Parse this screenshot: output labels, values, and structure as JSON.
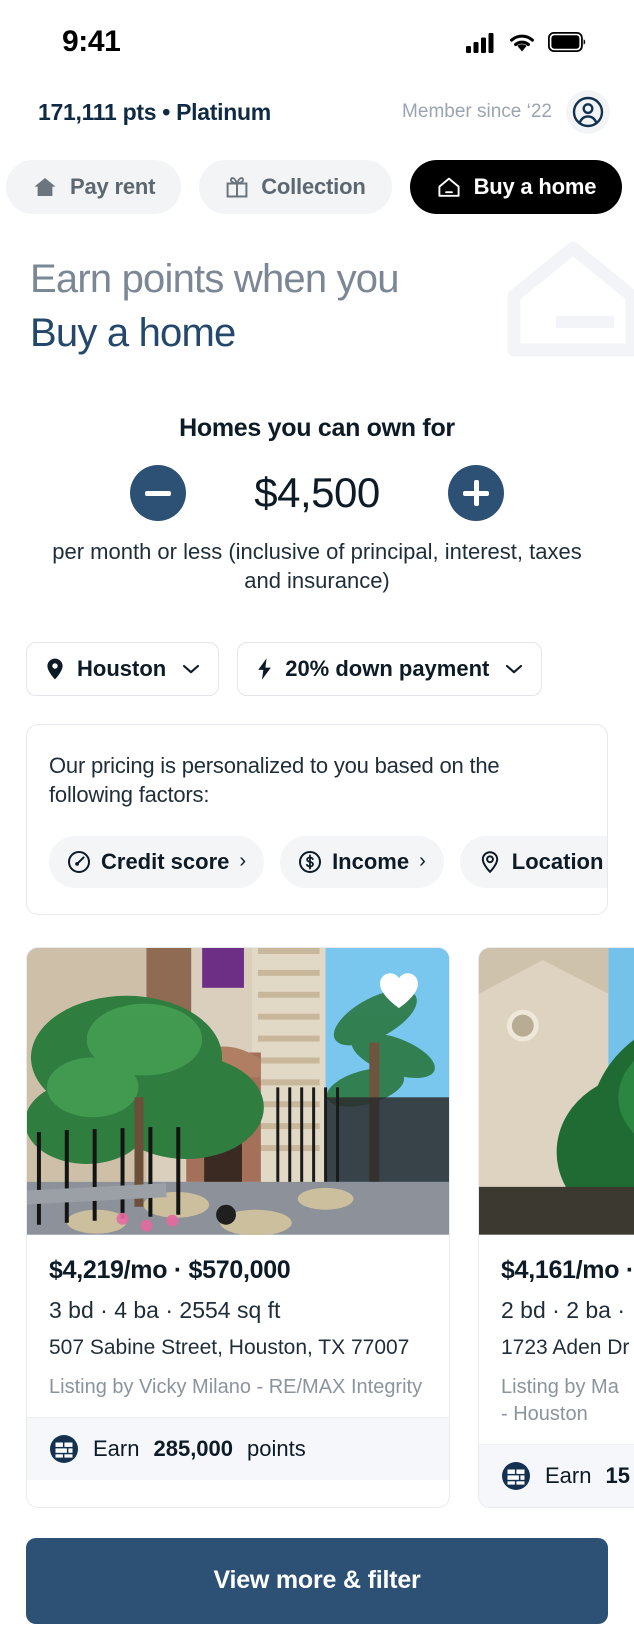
{
  "status_bar": {
    "time": "9:41",
    "cellular_icon": "signal-bars-icon",
    "wifi_icon": "wifi-icon",
    "battery_icon": "battery-icon"
  },
  "header": {
    "points_tier": "171,111 pts • Platinum",
    "member_since": "Member since ‘22",
    "avatar_icon": "user-avatar-icon"
  },
  "tabs": [
    {
      "label": "Pay rent",
      "icon": "house-filled-icon",
      "active": false
    },
    {
      "label": "Collection",
      "icon": "gift-icon",
      "active": false
    },
    {
      "label": "Buy a home",
      "icon": "house-outline-icon",
      "active": true
    }
  ],
  "hero": {
    "line1": "Earn points when you",
    "line2": "Buy a home",
    "watermark_icon": "house-watermark-icon"
  },
  "price_stepper": {
    "title": "Homes you can own for",
    "decrement_label": "−",
    "increment_label": "+",
    "amount": "$4,500",
    "subtitle": "per month or less (inclusive of principal, interest, taxes and insurance)"
  },
  "filters": [
    {
      "label": "Houston",
      "icon": "location-pin-icon",
      "caret": "chevron-down-icon"
    },
    {
      "label": "20% down payment",
      "icon": "bolt-icon",
      "caret": "chevron-down-icon"
    }
  ],
  "personalization": {
    "text": "Our pricing is personalized to you based on the following factors:",
    "factors": [
      {
        "label": "Credit score",
        "icon": "speedometer-icon",
        "chevron": "›"
      },
      {
        "label": "Income",
        "icon": "dollar-circle-icon",
        "chevron": "›"
      },
      {
        "label": "Location",
        "icon": "location-target-icon",
        "chevron": "›"
      }
    ]
  },
  "listings": [
    {
      "photo_alt": "brick-townhouse-entry-with-tree",
      "favorite_icon": "heart-filled-icon",
      "price": "$4,219/mo · $570,000",
      "specs": "3 bd · 4 ba · 2554 sq ft",
      "address": "507 Sabine Street, Houston, TX 77007",
      "agent": "Listing by Vicky Milano - RE/MAX Integrity",
      "points_icon": "points-badge-icon",
      "points_prefix": "Earn ",
      "points_value": "285,000",
      "points_suffix": " points"
    },
    {
      "photo_alt": "house-behind-large-green-tree",
      "price": "$4,161/mo ·",
      "specs": "2 bd · 2 ba ·",
      "address": "1723 Aden Dr",
      "agent": "Listing by Ma\n- Houston",
      "points_icon": "points-badge-icon",
      "points_prefix": "Earn ",
      "points_value": "15",
      "points_suffix": ""
    }
  ],
  "cta": {
    "label": "View more & filter"
  },
  "colors": {
    "accent_navy": "#2c5175",
    "hero_blue": "#24486b",
    "active_tab": "#000000",
    "pill_gray": "#f2f4f6",
    "muted_text": "#8b949d",
    "card_footer_bg": "#f5f7fa"
  }
}
